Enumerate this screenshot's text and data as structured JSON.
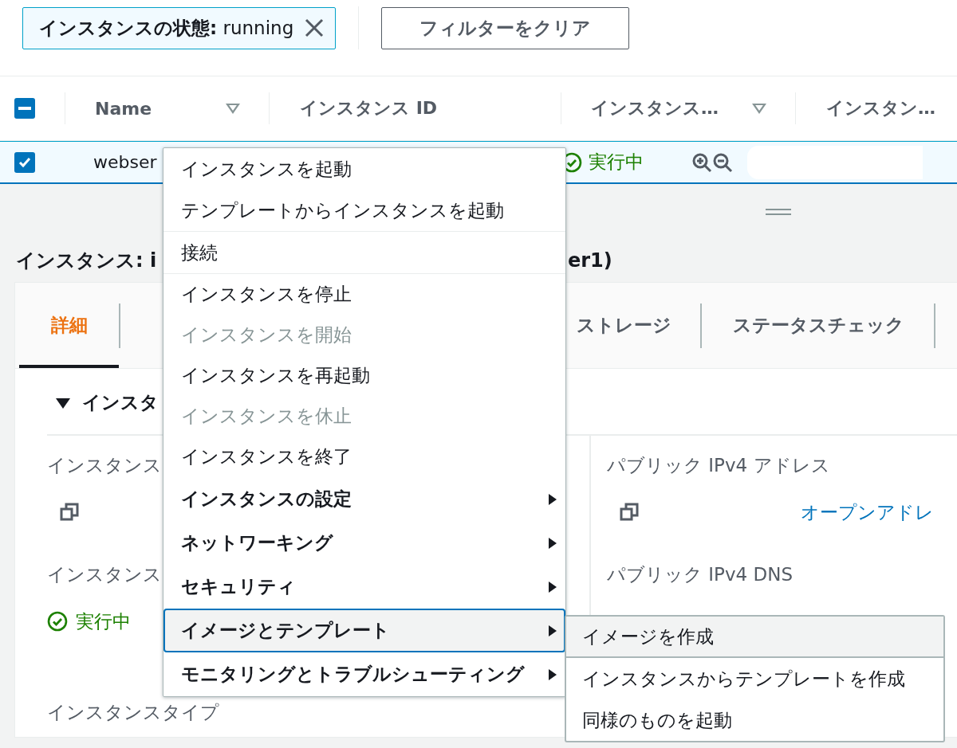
{
  "filters": {
    "chip": {
      "label": "**インスタンスの状態:** running"
    },
    "clear_button": "フィルターをクリア"
  },
  "table": {
    "select_all": {
      "indeterminate": true
    },
    "columns": [
      {
        "label": "Name",
        "sortable": true
      },
      {
        "label": "インスタンス ID",
        "sortable": false
      },
      {
        "label": "インスタンス…",
        "sortable": true
      },
      {
        "label": "インスタン…",
        "sortable": false
      }
    ],
    "rows": [
      {
        "selected": true,
        "name": "webser",
        "status": "実行中"
      }
    ]
  },
  "details": {
    "heading_start": "インスタンス: i",
    "heading_end": "er1)",
    "tabs": [
      {
        "label": "詳細",
        "selected": true
      },
      {
        "label": "ストレージ",
        "selected": false
      },
      {
        "label": "ステータスチェック",
        "selected": false
      }
    ],
    "section": {
      "title": "インスタ",
      "expanded": true
    },
    "left_fields": [
      {
        "label": "インスタンス",
        "kind": "copy"
      },
      {
        "label": "インスタンス",
        "kind": "status",
        "value": "実行中"
      },
      {
        "label": "インスタンスタイプ",
        "kind": "plain"
      }
    ],
    "right_fields": [
      {
        "label": "パブリック IPv4 アドレス",
        "kind": "copy_link",
        "value": "オープンアドレ"
      },
      {
        "label": "パブリック IPv4 DNS",
        "kind": "plain"
      }
    ]
  },
  "menu": {
    "groups": [
      {
        "items": [
          {
            "label": "インスタンスを起動",
            "kind": "action",
            "disabled": false,
            "selected": false
          },
          {
            "label": "テンプレートからインスタンスを起動",
            "kind": "action",
            "disabled": false,
            "selected": false
          }
        ]
      },
      {
        "items": [
          {
            "label": "接続",
            "kind": "action",
            "disabled": false,
            "selected": false
          }
        ]
      },
      {
        "items": [
          {
            "label": "インスタンスを停止",
            "kind": "action",
            "disabled": false,
            "selected": false
          },
          {
            "label": "インスタンスを開始",
            "kind": "action",
            "disabled": true,
            "selected": false
          },
          {
            "label": "インスタンスを再起動",
            "kind": "action",
            "disabled": false,
            "selected": false
          },
          {
            "label": "インスタンスを休止",
            "kind": "action",
            "disabled": true,
            "selected": false
          },
          {
            "label": "インスタンスを終了",
            "kind": "action",
            "disabled": false,
            "selected": false
          },
          {
            "label": "インスタンスの設定",
            "kind": "submenu",
            "disabled": false,
            "selected": false
          },
          {
            "label": "ネットワーキング",
            "kind": "submenu",
            "disabled": false,
            "selected": false
          },
          {
            "label": "セキュリティ",
            "kind": "submenu",
            "disabled": false,
            "selected": false
          },
          {
            "label": "イメージとテンプレート",
            "kind": "submenu",
            "disabled": false,
            "selected": true
          },
          {
            "label": "モニタリングとトラブルシューティング",
            "kind": "submenu",
            "disabled": false,
            "selected": false
          }
        ]
      }
    ],
    "submenu": [
      {
        "label": "イメージを作成",
        "selected": true
      },
      {
        "label": "インスタンスからテンプレートを作成",
        "selected": false
      },
      {
        "label": "同様のものを起動",
        "selected": false
      }
    ]
  }
}
